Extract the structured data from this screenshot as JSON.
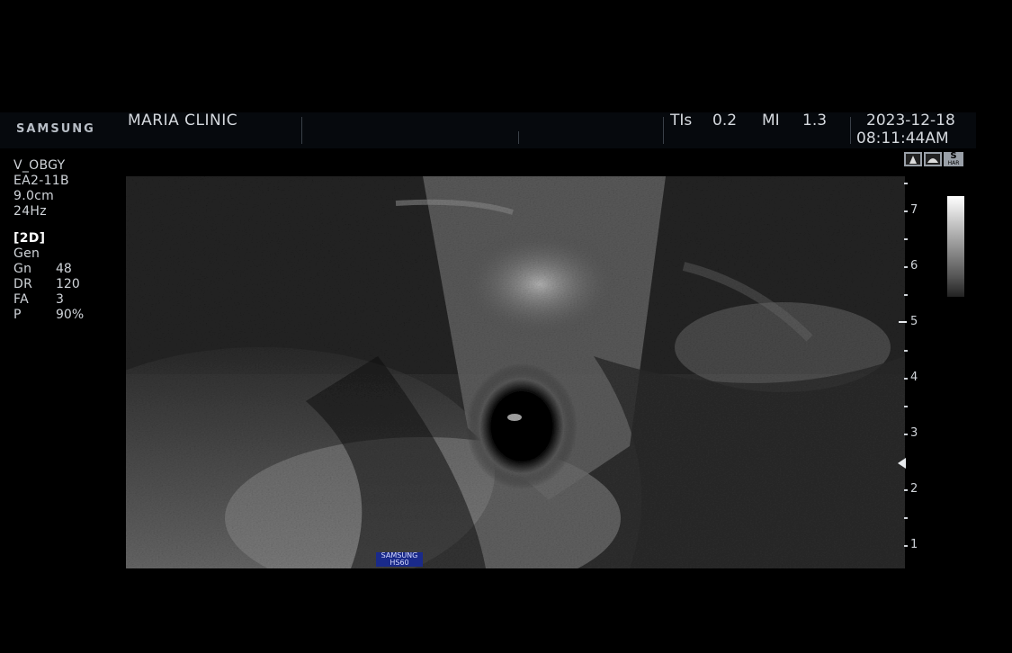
{
  "header": {
    "brand": "SAMSUNG",
    "clinic": "MARIA CLINIC",
    "tis_label": "TIs",
    "tis_value": "0.2",
    "mi_label": "MI",
    "mi_value": "1.3",
    "date": "2023-12-18",
    "time": "08:11:44AM"
  },
  "settings": {
    "preset": "V_OBGY",
    "probe": "EA2-11B",
    "depth": "9.0cm",
    "frame_rate": "24Hz",
    "mode": "[2D]",
    "mode_type": "Gen",
    "params": [
      {
        "label": "Gn",
        "value": "48"
      },
      {
        "label": "DR",
        "value": "120"
      },
      {
        "label": "FA",
        "value": "3"
      },
      {
        "label": "P",
        "value": "90%"
      }
    ]
  },
  "image": {
    "watermark_line1": "SAMSUNG",
    "watermark_line2": "HS60"
  },
  "icons": {
    "icon1": "fetus-icon",
    "icon2": "probe-icon",
    "har_s": "S",
    "har_label": "HAR"
  },
  "depth_scale": [
    "7",
    "6",
    "5",
    "4",
    "3",
    "2",
    "1"
  ]
}
